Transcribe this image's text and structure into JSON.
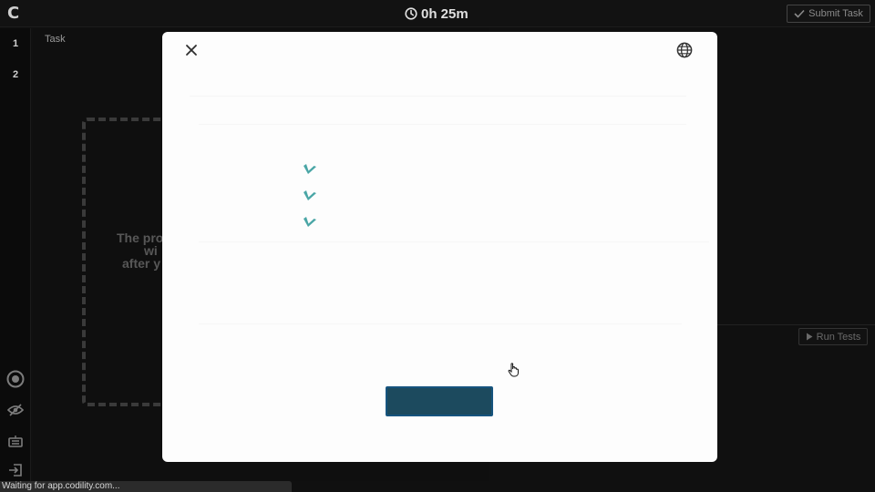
{
  "header": {
    "logo_text": "C",
    "timer": "0h 25m",
    "submit_label": "Submit Task"
  },
  "sidebar": {
    "tasks": [
      "1",
      "2"
    ],
    "icons": [
      "settings-icon",
      "eye-slash-icon",
      "keyboard-icon",
      "exit-icon"
    ]
  },
  "task_panel": {
    "label": "Task",
    "placeholder_lines": [
      "The pro",
      "wi",
      "after y"
    ]
  },
  "editor": {
    "run_tests_label": "Run Tests"
  },
  "modal": {
    "close_icon": "close-icon",
    "language_icon": "globe-icon",
    "checklist": [
      {
        "icon": "checkmark-icon",
        "text": ""
      },
      {
        "icon": "checkmark-icon",
        "text": ""
      },
      {
        "icon": "checkmark-icon",
        "text": ""
      }
    ],
    "primary_button_label": "",
    "accent_color": "#4aa6a6",
    "button_color": "#1c4a5e"
  },
  "statusbar": {
    "text": "Waiting for app.codility.com..."
  }
}
